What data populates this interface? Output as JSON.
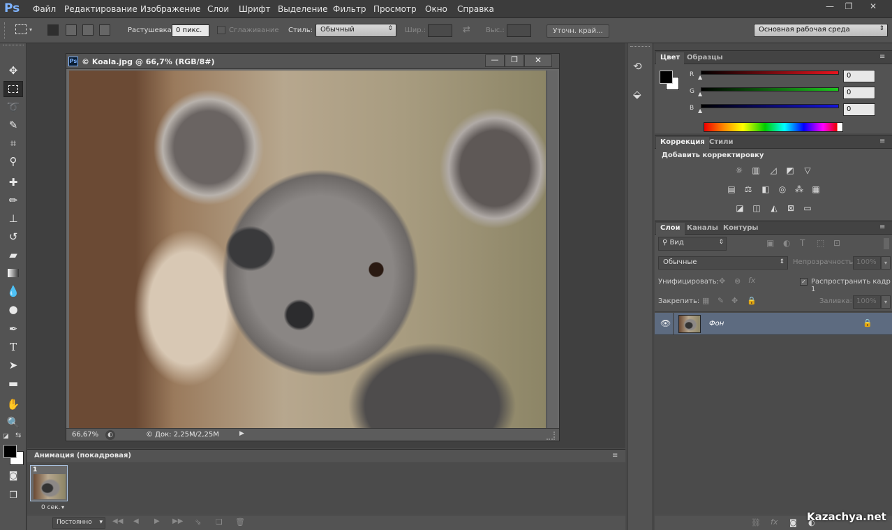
{
  "app": {
    "logo": "Ps"
  },
  "menu": [
    "Файл",
    "Редактирование",
    "Изображение",
    "Слои",
    "Шрифт",
    "Выделение",
    "Фильтр",
    "Просмотр",
    "Окно",
    "Справка"
  ],
  "window_controls": {
    "minimize": "—",
    "restore": "❐",
    "close": "✕"
  },
  "options_bar": {
    "feather_label": "Растушевка:",
    "feather_value": "0 пикс.",
    "antialias_label": "Сглаживание",
    "style_label": "Стиль:",
    "style_value": "Обычный",
    "width_label": "Шир.:",
    "height_label": "Выс.:",
    "refine_edge": "Уточн. край...",
    "workspace": "Основная рабочая среда"
  },
  "document": {
    "title": "© Koala.jpg @ 66,7% (RGB/8#)",
    "icon": "Ps",
    "zoom": "66,67%",
    "doc_size": "© Док: 2,25M/2,25M"
  },
  "animation": {
    "tab": "Анимация (покадровая)",
    "frame_number": "1",
    "frame_delay": "0 сек.",
    "loop": "Постоянно"
  },
  "color_panel": {
    "tabs": [
      "Цвет",
      "Образцы"
    ],
    "r_label": "R",
    "g_label": "G",
    "b_label": "B",
    "r": "0",
    "g": "0",
    "b": "0",
    "colors": {
      "r": "#e8141e",
      "g": "#1ec81e",
      "b": "#1414dc"
    }
  },
  "adjustments_panel": {
    "tabs": [
      "Коррекция",
      "Стили"
    ],
    "heading": "Добавить корректировку"
  },
  "layers_panel": {
    "tabs": [
      "Слои",
      "Каналы",
      "Контуры"
    ],
    "filter": "Вид",
    "blend_mode": "Обычные",
    "opacity_label": "Непрозрачность:",
    "opacity": "100%",
    "unify_label": "Унифицировать:",
    "propagate_label": "Распространить кадр 1",
    "lock_label": "Закрепить:",
    "fill_label": "Заливка:",
    "fill": "100%",
    "layers": [
      {
        "name": "Фон"
      }
    ]
  },
  "watermark": "Kazachya.net"
}
